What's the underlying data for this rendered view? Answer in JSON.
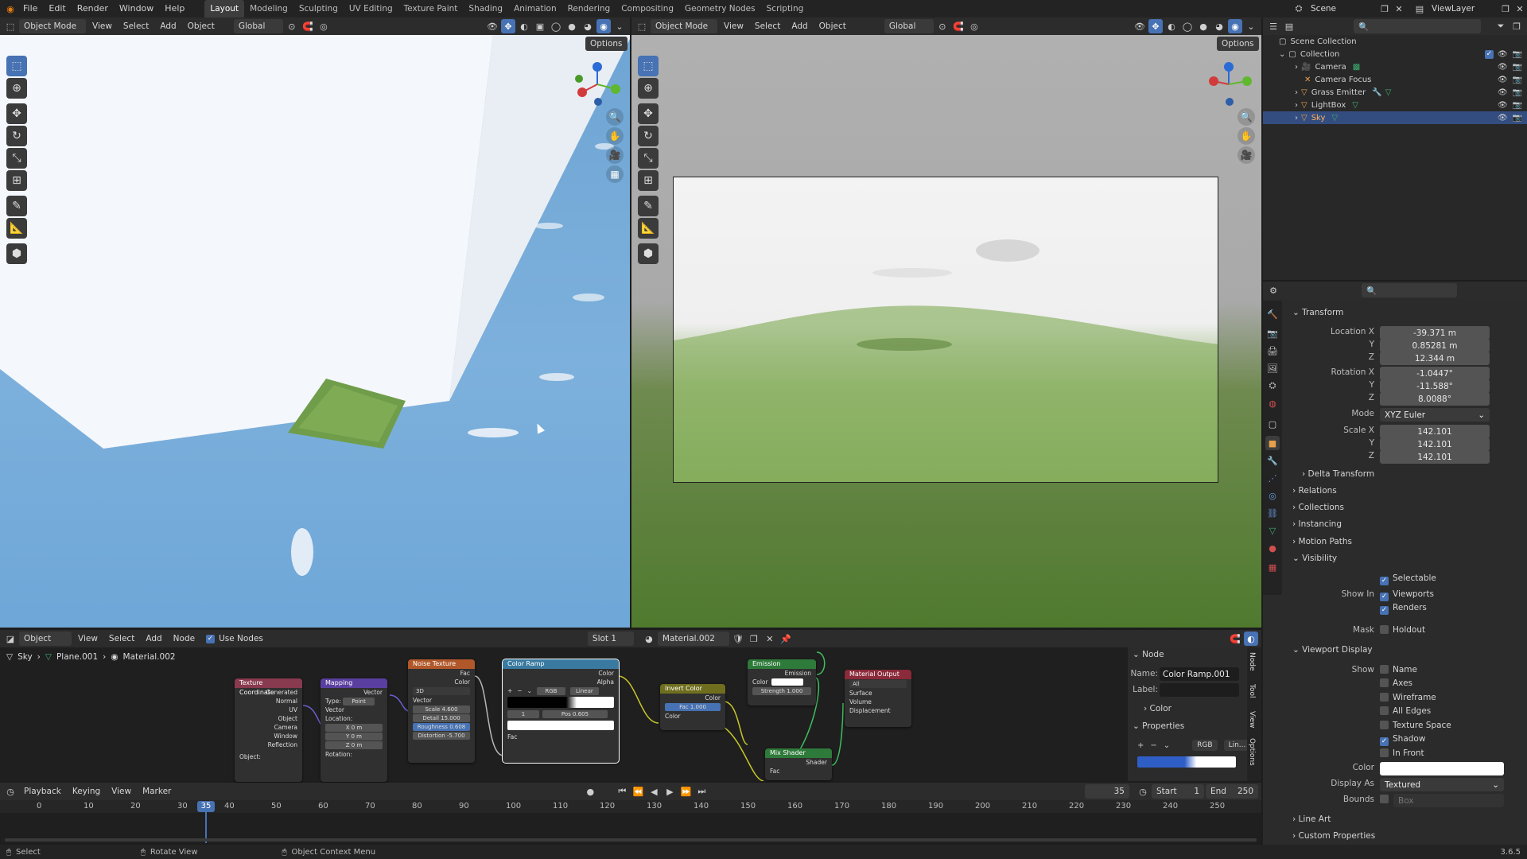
{
  "topbar": {
    "menus": [
      "File",
      "Edit",
      "Render",
      "Window",
      "Help"
    ],
    "workspaces": [
      "Layout",
      "Modeling",
      "Sculpting",
      "UV Editing",
      "Texture Paint",
      "Shading",
      "Animation",
      "Rendering",
      "Compositing",
      "Geometry Nodes",
      "Scripting"
    ],
    "active_workspace": "Layout",
    "scene": "Scene",
    "view_layer": "ViewLayer"
  },
  "viewport_left": {
    "mode": "Object Mode",
    "menus": [
      "View",
      "Select",
      "Add",
      "Object"
    ],
    "transform": "Global",
    "options": "Options"
  },
  "viewport_right": {
    "mode": "Object Mode",
    "menus": [
      "View",
      "Select",
      "Add",
      "Object"
    ],
    "transform": "Global",
    "options": "Options"
  },
  "outliner": {
    "root": "Scene Collection",
    "collection": "Collection",
    "items": [
      {
        "name": "Camera",
        "selected": false
      },
      {
        "name": "Camera Focus",
        "selected": false
      },
      {
        "name": "Grass Emitter",
        "selected": false
      },
      {
        "name": "LightBox",
        "selected": false
      },
      {
        "name": "Sky",
        "selected": true
      }
    ]
  },
  "properties": {
    "transform_title": "Transform",
    "location_label": "Location X",
    "loc_x": "-39.371 m",
    "loc_y": "0.85281 m",
    "loc_z": "12.344 m",
    "rotation_label": "Rotation X",
    "rot_x": "-1.0447°",
    "rot_y": "-11.588°",
    "rot_z": "8.0088°",
    "mode_label": "Mode",
    "mode_value": "XYZ Euler",
    "scale_label": "Scale X",
    "scale_x": "142.101",
    "scale_y": "142.101",
    "scale_z": "142.101",
    "y": "Y",
    "z": "Z",
    "delta_transform": "Delta Transform",
    "relations": "Relations",
    "collections": "Collections",
    "instancing": "Instancing",
    "motion_paths": "Motion Paths",
    "visibility": "Visibility",
    "selectable": "Selectable",
    "show_in": "Show In",
    "viewports": "Viewports",
    "renders": "Renders",
    "mask": "Mask",
    "holdout": "Holdout",
    "viewport_display": "Viewport Display",
    "show": "Show",
    "name": "Name",
    "axes": "Axes",
    "wireframe": "Wireframe",
    "all_edges": "All Edges",
    "texture_space": "Texture Space",
    "shadow": "Shadow",
    "in_front": "In Front",
    "color": "Color",
    "display_as": "Display As",
    "display_as_value": "Textured",
    "bounds": "Bounds",
    "bounds_value": "Box",
    "line_art": "Line Art",
    "custom_properties": "Custom Properties"
  },
  "node_editor": {
    "editor_type": "Object",
    "menus": [
      "View",
      "Select",
      "Add",
      "Node"
    ],
    "use_nodes": "Use Nodes",
    "slot": "Slot 1",
    "material": "Material.002",
    "breadcrumb": [
      "Sky",
      "Plane.001",
      "Material.002"
    ],
    "sidebar": {
      "section": "Node",
      "name_label": "Name:",
      "name_value": "Color Ramp.001",
      "label_label": "Label:",
      "color": "Color",
      "properties": "Properties",
      "rgb": "RGB",
      "lin": "Lin...",
      "tabs": [
        "Node",
        "Tool",
        "View",
        "Options"
      ]
    },
    "nodes": {
      "texcoord": {
        "title": "Texture Coordinate",
        "outputs": [
          "Generated",
          "Normal",
          "UV",
          "Object",
          "Camera",
          "Window",
          "Reflection"
        ],
        "object": "Object:"
      },
      "mapping": {
        "title": "Mapping",
        "vector": "Vector",
        "type_label": "Type:",
        "type_value": "Point",
        "vector_in": "Vector",
        "location": "Location:",
        "x": "X",
        "y": "Y",
        "z": "Z",
        "x_val": "0 m",
        "y_val": "0 m",
        "z_val": "0 m",
        "rotation": "Rotation:"
      },
      "noise": {
        "title": "Noise Texture",
        "fac": "Fac",
        "color": "Color",
        "dim": "3D",
        "vector": "Vector",
        "scale": "Scale",
        "scale_val": "4.600",
        "detail": "Detail",
        "detail_val": "15.000",
        "roughness": "Roughness",
        "roughness_val": "0.608",
        "distortion": "Distortion",
        "distortion_val": "-5.700"
      },
      "colorramp": {
        "title": "Color Ramp",
        "color": "Color",
        "alpha": "Alpha",
        "rgb": "RGB",
        "linear": "Linear",
        "idx": "1",
        "pos": "Pos",
        "pos_val": "0.605",
        "fac": "Fac"
      },
      "invert": {
        "title": "Invert Color",
        "color": "Color",
        "fac": "Fac",
        "fac_val": "1.000",
        "color_in": "Color"
      },
      "emission": {
        "title": "Emission",
        "emission": "Emission",
        "color": "Color",
        "strength": "Strength",
        "strength_val": "1.000"
      },
      "mix": {
        "title": "Mix Shader",
        "shader": "Shader",
        "fac": "Fac"
      },
      "output": {
        "title": "Material Output",
        "target": "All",
        "surface": "Surface",
        "volume": "Volume",
        "displacement": "Displacement"
      }
    }
  },
  "timeline": {
    "menus": [
      "Playback",
      "Keying",
      "View",
      "Marker"
    ],
    "current_frame": "35",
    "start_label": "Start",
    "start": "1",
    "end_label": "End",
    "end": "250",
    "ticks": [
      "0",
      "10",
      "20",
      "30",
      "35",
      "40",
      "50",
      "60",
      "70",
      "80",
      "90",
      "100",
      "110",
      "120",
      "130",
      "140",
      "150",
      "160",
      "170",
      "180",
      "190",
      "200",
      "210",
      "220",
      "230",
      "240",
      "250"
    ]
  },
  "statusbar": {
    "select": "Select",
    "rotate": "Rotate View",
    "context": "Object Context Menu",
    "version": "3.6.5"
  }
}
